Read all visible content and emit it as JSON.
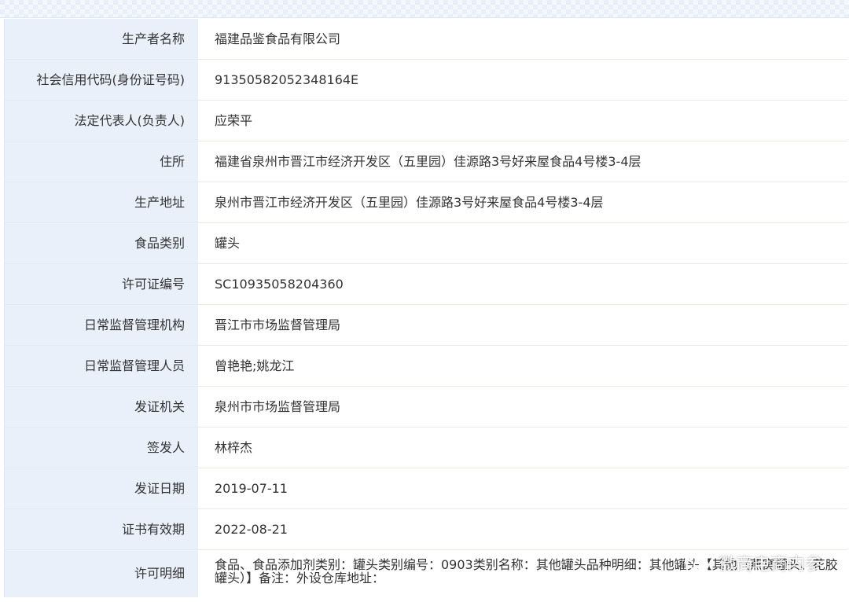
{
  "rows": [
    {
      "label": "生产者名称",
      "value": "福建品鉴食品有限公司"
    },
    {
      "label": "社会信用代码(身份证号码)",
      "value": "91350582052348164E"
    },
    {
      "label": "法定代表人(负责人)",
      "value": "应荣平"
    },
    {
      "label": "住所",
      "value": "福建省泉州市晋江市经济开发区（五里园）佳源路3号好来屋食品4号楼3-4层"
    },
    {
      "label": "生产地址",
      "value": "泉州市晋江市经济开发区（五里园）佳源路3号好来屋食品4号楼3-4层"
    },
    {
      "label": "食品类别",
      "value": "罐头"
    },
    {
      "label": "许可证编号",
      "value": "SC10935058204360"
    },
    {
      "label": "日常监督管理机构",
      "value": "晋江市市场监督管理局"
    },
    {
      "label": "日常监督管理人员",
      "value": "曾艳艳;姚龙江"
    },
    {
      "label": "发证机关",
      "value": "泉州市市场监督管理局"
    },
    {
      "label": "签发人",
      "value": "林梓杰"
    },
    {
      "label": "发证日期",
      "value": "2019-07-11"
    },
    {
      "label": "证书有效期",
      "value": "2022-08-21"
    },
    {
      "label": "许可明细",
      "value": "食品、食品添加剂类别：罐头类别编号：0903类别名称：其他罐头品种明细：其他罐头【其他（燕窝罐头、花胶罐头）】备注：外设仓库地址："
    }
  ],
  "watermark": {
    "text": "微商电商内参",
    "icon": "wechat-icon"
  }
}
